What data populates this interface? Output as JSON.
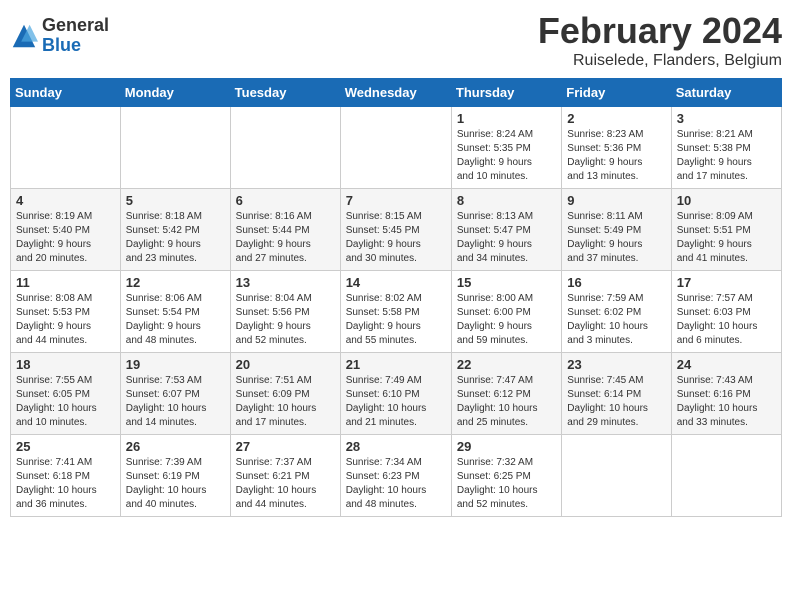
{
  "logo": {
    "general": "General",
    "blue": "Blue"
  },
  "title": "February 2024",
  "location": "Ruiselede, Flanders, Belgium",
  "weekdays": [
    "Sunday",
    "Monday",
    "Tuesday",
    "Wednesday",
    "Thursday",
    "Friday",
    "Saturday"
  ],
  "weeks": [
    [
      {
        "day": "",
        "info": ""
      },
      {
        "day": "",
        "info": ""
      },
      {
        "day": "",
        "info": ""
      },
      {
        "day": "",
        "info": ""
      },
      {
        "day": "1",
        "info": "Sunrise: 8:24 AM\nSunset: 5:35 PM\nDaylight: 9 hours\nand 10 minutes."
      },
      {
        "day": "2",
        "info": "Sunrise: 8:23 AM\nSunset: 5:36 PM\nDaylight: 9 hours\nand 13 minutes."
      },
      {
        "day": "3",
        "info": "Sunrise: 8:21 AM\nSunset: 5:38 PM\nDaylight: 9 hours\nand 17 minutes."
      }
    ],
    [
      {
        "day": "4",
        "info": "Sunrise: 8:19 AM\nSunset: 5:40 PM\nDaylight: 9 hours\nand 20 minutes."
      },
      {
        "day": "5",
        "info": "Sunrise: 8:18 AM\nSunset: 5:42 PM\nDaylight: 9 hours\nand 23 minutes."
      },
      {
        "day": "6",
        "info": "Sunrise: 8:16 AM\nSunset: 5:44 PM\nDaylight: 9 hours\nand 27 minutes."
      },
      {
        "day": "7",
        "info": "Sunrise: 8:15 AM\nSunset: 5:45 PM\nDaylight: 9 hours\nand 30 minutes."
      },
      {
        "day": "8",
        "info": "Sunrise: 8:13 AM\nSunset: 5:47 PM\nDaylight: 9 hours\nand 34 minutes."
      },
      {
        "day": "9",
        "info": "Sunrise: 8:11 AM\nSunset: 5:49 PM\nDaylight: 9 hours\nand 37 minutes."
      },
      {
        "day": "10",
        "info": "Sunrise: 8:09 AM\nSunset: 5:51 PM\nDaylight: 9 hours\nand 41 minutes."
      }
    ],
    [
      {
        "day": "11",
        "info": "Sunrise: 8:08 AM\nSunset: 5:53 PM\nDaylight: 9 hours\nand 44 minutes."
      },
      {
        "day": "12",
        "info": "Sunrise: 8:06 AM\nSunset: 5:54 PM\nDaylight: 9 hours\nand 48 minutes."
      },
      {
        "day": "13",
        "info": "Sunrise: 8:04 AM\nSunset: 5:56 PM\nDaylight: 9 hours\nand 52 minutes."
      },
      {
        "day": "14",
        "info": "Sunrise: 8:02 AM\nSunset: 5:58 PM\nDaylight: 9 hours\nand 55 minutes."
      },
      {
        "day": "15",
        "info": "Sunrise: 8:00 AM\nSunset: 6:00 PM\nDaylight: 9 hours\nand 59 minutes."
      },
      {
        "day": "16",
        "info": "Sunrise: 7:59 AM\nSunset: 6:02 PM\nDaylight: 10 hours\nand 3 minutes."
      },
      {
        "day": "17",
        "info": "Sunrise: 7:57 AM\nSunset: 6:03 PM\nDaylight: 10 hours\nand 6 minutes."
      }
    ],
    [
      {
        "day": "18",
        "info": "Sunrise: 7:55 AM\nSunset: 6:05 PM\nDaylight: 10 hours\nand 10 minutes."
      },
      {
        "day": "19",
        "info": "Sunrise: 7:53 AM\nSunset: 6:07 PM\nDaylight: 10 hours\nand 14 minutes."
      },
      {
        "day": "20",
        "info": "Sunrise: 7:51 AM\nSunset: 6:09 PM\nDaylight: 10 hours\nand 17 minutes."
      },
      {
        "day": "21",
        "info": "Sunrise: 7:49 AM\nSunset: 6:10 PM\nDaylight: 10 hours\nand 21 minutes."
      },
      {
        "day": "22",
        "info": "Sunrise: 7:47 AM\nSunset: 6:12 PM\nDaylight: 10 hours\nand 25 minutes."
      },
      {
        "day": "23",
        "info": "Sunrise: 7:45 AM\nSunset: 6:14 PM\nDaylight: 10 hours\nand 29 minutes."
      },
      {
        "day": "24",
        "info": "Sunrise: 7:43 AM\nSunset: 6:16 PM\nDaylight: 10 hours\nand 33 minutes."
      }
    ],
    [
      {
        "day": "25",
        "info": "Sunrise: 7:41 AM\nSunset: 6:18 PM\nDaylight: 10 hours\nand 36 minutes."
      },
      {
        "day": "26",
        "info": "Sunrise: 7:39 AM\nSunset: 6:19 PM\nDaylight: 10 hours\nand 40 minutes."
      },
      {
        "day": "27",
        "info": "Sunrise: 7:37 AM\nSunset: 6:21 PM\nDaylight: 10 hours\nand 44 minutes."
      },
      {
        "day": "28",
        "info": "Sunrise: 7:34 AM\nSunset: 6:23 PM\nDaylight: 10 hours\nand 48 minutes."
      },
      {
        "day": "29",
        "info": "Sunrise: 7:32 AM\nSunset: 6:25 PM\nDaylight: 10 hours\nand 52 minutes."
      },
      {
        "day": "",
        "info": ""
      },
      {
        "day": "",
        "info": ""
      }
    ]
  ]
}
